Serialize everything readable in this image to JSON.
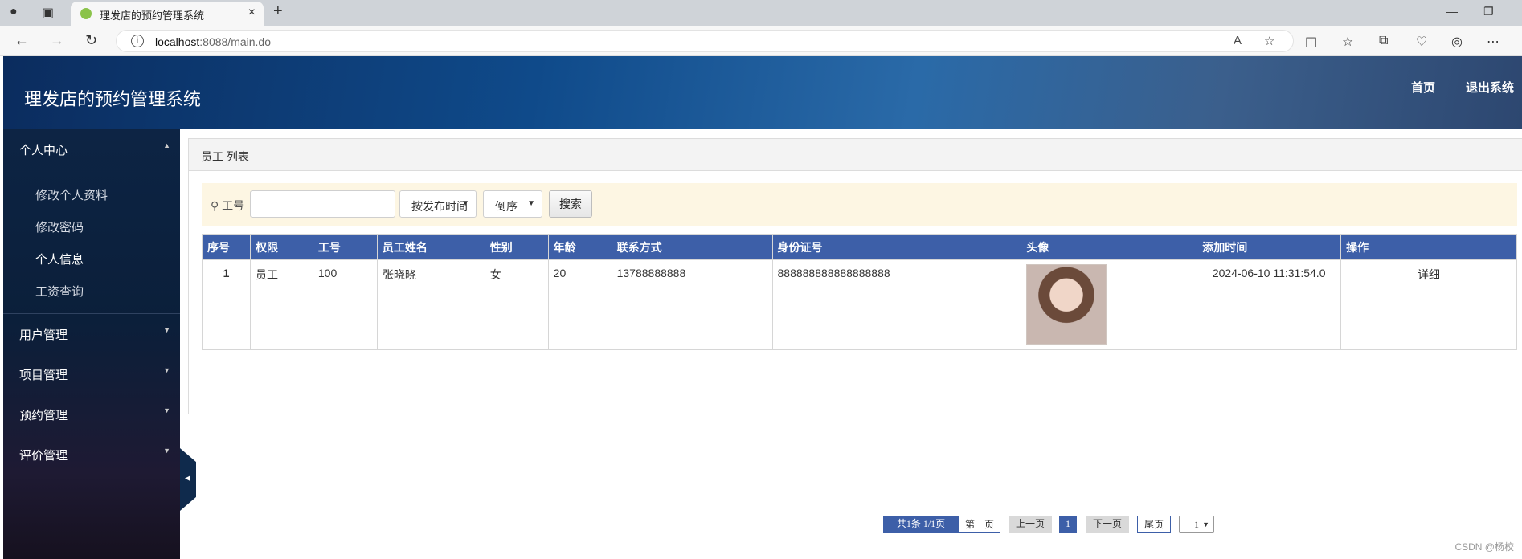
{
  "browser": {
    "tab_title": "理发店的预约管理系统",
    "url_host": "localhost",
    "url_rest": ":8088/main.do"
  },
  "header": {
    "brand": "理发店的预约管理系统",
    "nav_home": "首页",
    "nav_logout": "退出系统"
  },
  "sidebar": {
    "personal_center": "个人中心",
    "personal_items": [
      "修改个人资料",
      "修改密码",
      "个人信息",
      "工资查询"
    ],
    "groups": [
      "用户管理",
      "项目管理",
      "预约管理",
      "评价管理"
    ]
  },
  "panel": {
    "title": "员工 列表"
  },
  "search": {
    "label": "工号",
    "input_value": "",
    "sort_field": "按发布时间",
    "sort_order": "倒序",
    "button": "搜索"
  },
  "table": {
    "headers": [
      "序号",
      "权限",
      "工号",
      "员工姓名",
      "性别",
      "年龄",
      "联系方式",
      "身份证号",
      "头像",
      "添加时间",
      "操作"
    ],
    "rows": [
      {
        "index": "1",
        "role": "员工",
        "emp_no": "100",
        "name": "张晓晓",
        "gender": "女",
        "age": "20",
        "phone": "13788888888",
        "id_card": "888888888888888888",
        "added": "2024-06-10 11:31:54.0",
        "action": "详细"
      }
    ]
  },
  "pager": {
    "info": "共1条  1/1页",
    "first": "第一页",
    "prev": "上一页",
    "current": "1",
    "next": "下一页",
    "last": "尾页",
    "select_value": "1"
  },
  "watermark": "CSDN @杨校"
}
